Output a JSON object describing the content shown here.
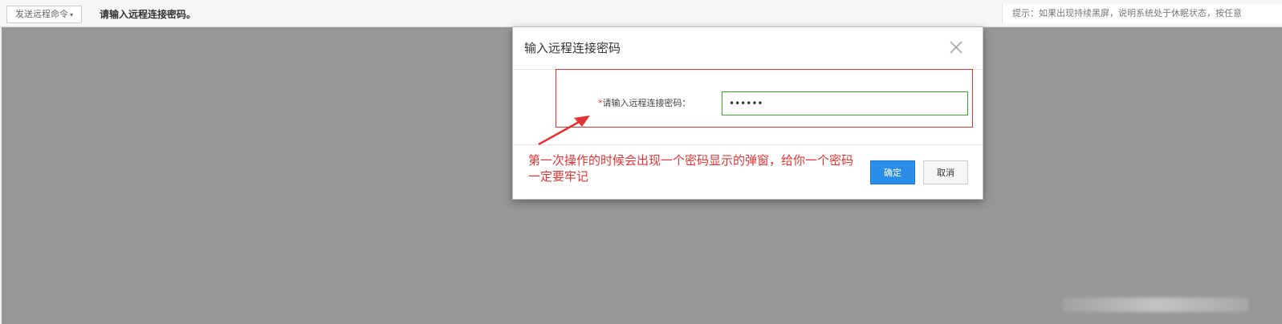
{
  "toolbar": {
    "send_command_label": "发送远程命令",
    "caret": "▾",
    "message": "请输入远程连接密码。",
    "hint": "提示：如果出现持续黑屏，说明系统处于休眠状态，按任意"
  },
  "dialog": {
    "title": "输入远程连接密码",
    "required_mark": "*",
    "field_label": "请输入远程连接密码：",
    "password_value": "••••••",
    "ok_label": "确定",
    "cancel_label": "取消"
  },
  "annotation": {
    "line1": "第一次操作的时候会出现一个密码显示的弹窗，给你一个密码",
    "line2": "一定要牢记",
    "color": "#e53333"
  },
  "colors": {
    "screen_bg": "#979797",
    "primary_button": "#2b8ee6",
    "input_focus_border": "#3aa329"
  }
}
